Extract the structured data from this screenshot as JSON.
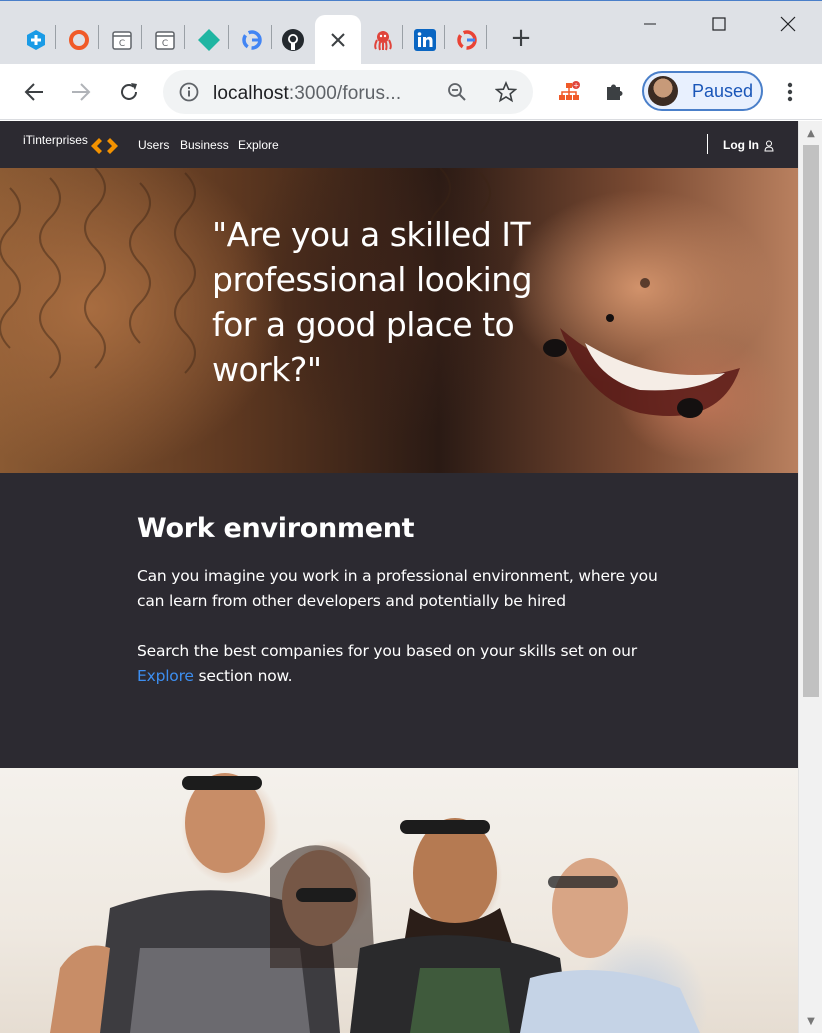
{
  "browser": {
    "tabs": [
      {
        "icon": "plus-hexagon-icon",
        "color": "#1a9be6"
      },
      {
        "icon": "ring-icon",
        "color": "#f05a28"
      },
      {
        "icon": "calendar-c-icon",
        "color": "#5f6368"
      },
      {
        "icon": "calendar-c-icon",
        "color": "#5f6368"
      },
      {
        "icon": "diamond-icon",
        "color": "#1fb5a2"
      },
      {
        "icon": "google-icon",
        "color": "#4285f4"
      },
      {
        "icon": "github-icon",
        "color": "#24292e"
      },
      {
        "icon": "close-icon",
        "color": "#3c4043"
      },
      {
        "icon": "octopus-icon",
        "color": "#e0443b"
      },
      {
        "icon": "linkedin-icon",
        "color": "#0a66c2"
      },
      {
        "icon": "google-icon",
        "color": "#4285f4"
      }
    ],
    "new_tab_label": "+",
    "address": {
      "host": "localhost",
      "path": ":3000/forus..."
    },
    "profile_label": "Paused"
  },
  "site": {
    "brand": "iTinterprises",
    "nav": {
      "users": "Users",
      "business": "Business",
      "explore": "Explore",
      "login": "Log In"
    },
    "hero": {
      "quote": "\"Are you a skilled IT professional looking for a good place to work?\""
    },
    "work": {
      "title": "Work environment",
      "p1": "Can you imagine you work in a professional environment, where you can learn from other developers and potentially be hired",
      "p2_before": "Search the best companies for you based on your skills set on our",
      "p2_link": "Explore",
      "p2_after": " section now."
    },
    "colors": {
      "nav_bg": "#2c2a31",
      "accent": "#f39200",
      "link": "#3d8ef0"
    }
  }
}
